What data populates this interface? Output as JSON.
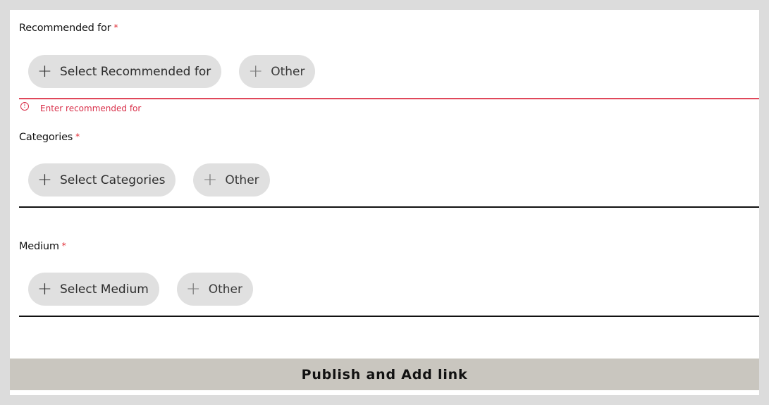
{
  "form": {
    "required_marker": "*",
    "recommended": {
      "label": "Recommended for",
      "select_label": "Select Recommended for",
      "other_label": "Other",
      "error_icon": "!",
      "error_text": "Enter recommended for"
    },
    "categories": {
      "label": "Categories",
      "select_label": "Select Categories",
      "other_label": "Other"
    },
    "medium": {
      "label": "Medium",
      "select_label": "Select Medium",
      "other_label": "Other"
    },
    "plus_glyph": "+",
    "publish_label": "Publish and Add link"
  },
  "colors": {
    "required": "#e02a33",
    "error": "#d9304a",
    "chip_bg": "#e0e0e0",
    "publish_bg": "#c9c6bf"
  },
  "icons": {
    "add": "plus-icon",
    "error": "error-circle-icon"
  }
}
